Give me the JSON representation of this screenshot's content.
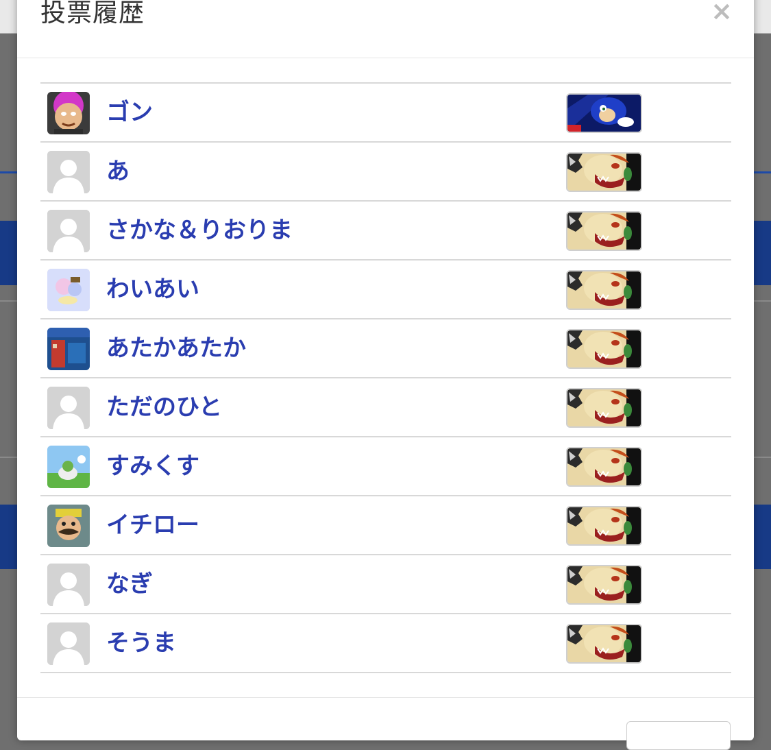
{
  "modal": {
    "title": "投票履歴",
    "close_glyph": "×"
  },
  "votes": [
    {
      "name": "ゴン",
      "avatar": "custom-pink-hair-character",
      "fighter": "sonic"
    },
    {
      "name": "あ",
      "avatar": "default-user",
      "fighter": "bowser"
    },
    {
      "name": "さかな＆りおりま",
      "avatar": "default-user",
      "fighter": "bowser"
    },
    {
      "name": "わいあい",
      "avatar": "custom-pastel-illustration",
      "fighter": "bowser"
    },
    {
      "name": "あたかあたか",
      "avatar": "custom-photo",
      "fighter": "bowser"
    },
    {
      "name": "ただのひと",
      "avatar": "default-user",
      "fighter": "bowser"
    },
    {
      "name": "すみくす",
      "avatar": "custom-game-scene",
      "fighter": "bowser"
    },
    {
      "name": "イチロー",
      "avatar": "custom-wario",
      "fighter": "bowser"
    },
    {
      "name": "なぎ",
      "avatar": "default-user",
      "fighter": "bowser"
    },
    {
      "name": "そうま",
      "avatar": "default-user",
      "fighter": "bowser"
    }
  ],
  "colors": {
    "username": "#2a3db0",
    "title": "#333333",
    "divider": "#d8d8d8"
  }
}
